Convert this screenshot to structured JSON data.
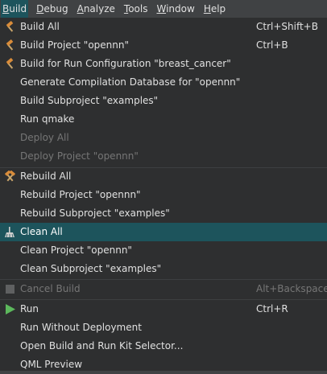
{
  "menubar": {
    "items": [
      {
        "label": "Build",
        "underline": "B",
        "rest": "uild"
      },
      {
        "label": "Debug",
        "underline": "D",
        "rest": "ebug"
      },
      {
        "label": "Analyze",
        "underline": "A",
        "rest": "nalyze"
      },
      {
        "label": "Tools",
        "underline": "T",
        "rest": "ools"
      },
      {
        "label": "Window",
        "underline": "W",
        "rest": "indow"
      },
      {
        "label": "Help",
        "underline": "H",
        "rest": "elp"
      }
    ]
  },
  "menu": {
    "items": [
      {
        "label": "Build All",
        "shortcut": "Ctrl+Shift+B",
        "icon": "hammer-icon"
      },
      {
        "label": "Build Project \"opennn\"",
        "shortcut": "Ctrl+B",
        "icon": "hammer-icon"
      },
      {
        "label": "Build for Run Configuration \"breast_cancer\"",
        "shortcut": "",
        "icon": "hammer-icon"
      },
      {
        "label": "Generate Compilation Database for \"opennn\"",
        "shortcut": ""
      },
      {
        "label": "Build Subproject \"examples\"",
        "shortcut": ""
      },
      {
        "label": "Run qmake",
        "shortcut": ""
      },
      {
        "label": "Deploy All",
        "shortcut": ""
      },
      {
        "label": "Deploy Project \"opennn\"",
        "shortcut": ""
      },
      {
        "label": "Rebuild All",
        "shortcut": "",
        "icon": "rebuild-hammers-icon"
      },
      {
        "label": "Rebuild Project \"opennn\"",
        "shortcut": ""
      },
      {
        "label": "Rebuild Subproject \"examples\"",
        "shortcut": ""
      },
      {
        "label": "Clean All",
        "shortcut": "",
        "icon": "broom-icon"
      },
      {
        "label": "Clean Project \"opennn\"",
        "shortcut": ""
      },
      {
        "label": "Clean Subproject \"examples\"",
        "shortcut": ""
      },
      {
        "label": "Cancel Build",
        "shortcut": "Alt+Backspace",
        "icon": "stop-icon"
      },
      {
        "label": "Run",
        "shortcut": "Ctrl+R",
        "icon": "run-icon"
      },
      {
        "label": "Run Without Deployment",
        "shortcut": ""
      },
      {
        "label": "Open Build and Run Kit Selector...",
        "shortcut": ""
      },
      {
        "label": "QML Preview",
        "shortcut": ""
      }
    ]
  },
  "colors": {
    "highlight": "#1d545c",
    "run_green": "#5cb85c",
    "hammer_orange": "#d98c3a"
  }
}
